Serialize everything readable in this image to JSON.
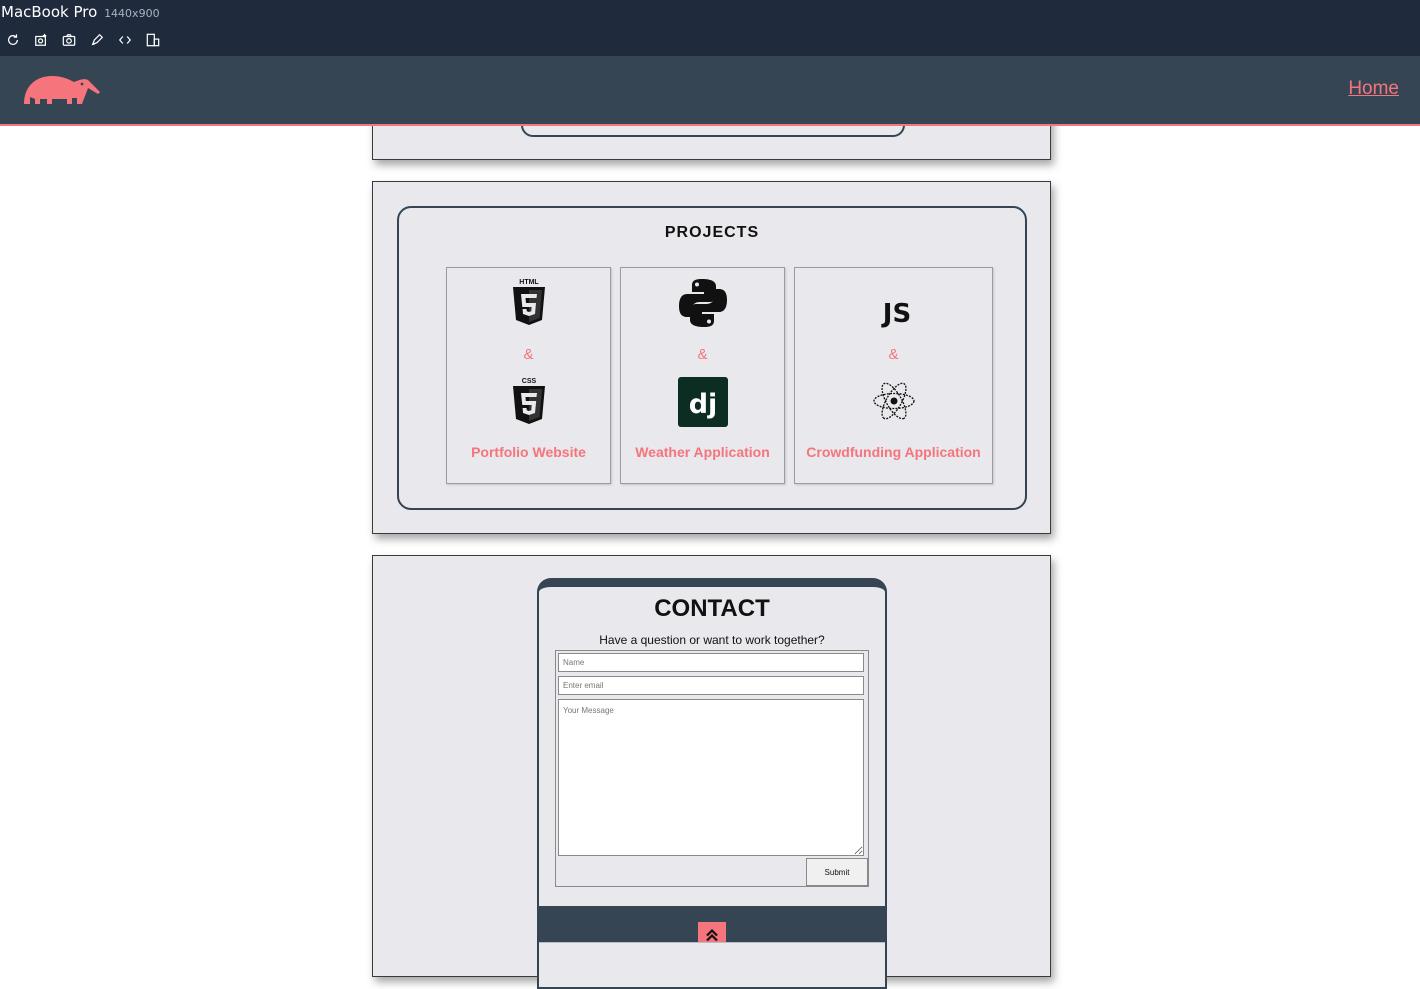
{
  "devtools": {
    "device_name": "MacBook Pro",
    "device_size": "1440x900",
    "tools": [
      {
        "name": "reload-icon"
      },
      {
        "name": "screenshot-element-icon"
      },
      {
        "name": "camera-icon"
      },
      {
        "name": "pen-icon"
      },
      {
        "name": "code-icon"
      },
      {
        "name": "responsive-icon"
      }
    ]
  },
  "nav": {
    "logo": "anteater-logo",
    "home_link": "Home",
    "colors": {
      "bar": "#354553",
      "accent": "#f6747c"
    }
  },
  "projects": {
    "title": "PROJECTS",
    "cards": [
      {
        "icon_top": "html5-icon",
        "connector": "&",
        "icon_bottom": "css3-icon",
        "label": "Portfolio Website"
      },
      {
        "icon_top": "python-icon",
        "connector": "&",
        "icon_bottom": "django-icon",
        "label": "Weather Application"
      },
      {
        "icon_top": "javascript-icon",
        "top_text": "JS",
        "connector": "&",
        "icon_bottom": "react-icon",
        "label": "Crowdfunding Application"
      }
    ]
  },
  "contact": {
    "title": "CONTACT",
    "subtitle": "Have a question or want to work together?",
    "name_placeholder": "Name",
    "email_placeholder": "Enter email",
    "message_placeholder": "Your Message",
    "submit_label": "Submit",
    "scroll_top_icon": "double-chevron-up-icon"
  }
}
